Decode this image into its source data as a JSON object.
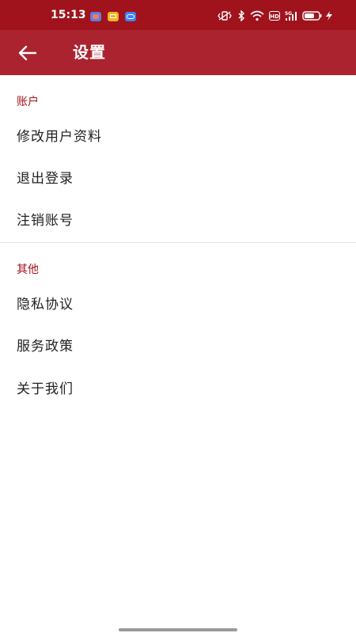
{
  "status_bar": {
    "time": "15:13",
    "hd_badge": "HD",
    "icons": [
      "notification-app-icon",
      "notification-message-icon",
      "notification-link-icon",
      "vibrate-icon",
      "bluetooth-icon",
      "wifi-icon",
      "hd-icon",
      "signal-icon",
      "battery-icon",
      "charging-icon"
    ],
    "battery_level": 0.7
  },
  "app_bar": {
    "back_icon": "arrow-left-icon",
    "title": "设置"
  },
  "sections": [
    {
      "header": "账户",
      "items": [
        {
          "label": "修改用户资料"
        },
        {
          "label": "退出登录"
        },
        {
          "label": "注销账号"
        }
      ]
    },
    {
      "header": "其他",
      "items": [
        {
          "label": "隐私协议"
        },
        {
          "label": "服务政策"
        },
        {
          "label": "关于我们"
        }
      ]
    }
  ],
  "colors": {
    "status_bar": "#a0131d",
    "app_bar": "#ac2330",
    "section_header": "#a0131d",
    "text": "#222222",
    "background": "#ffffff"
  }
}
